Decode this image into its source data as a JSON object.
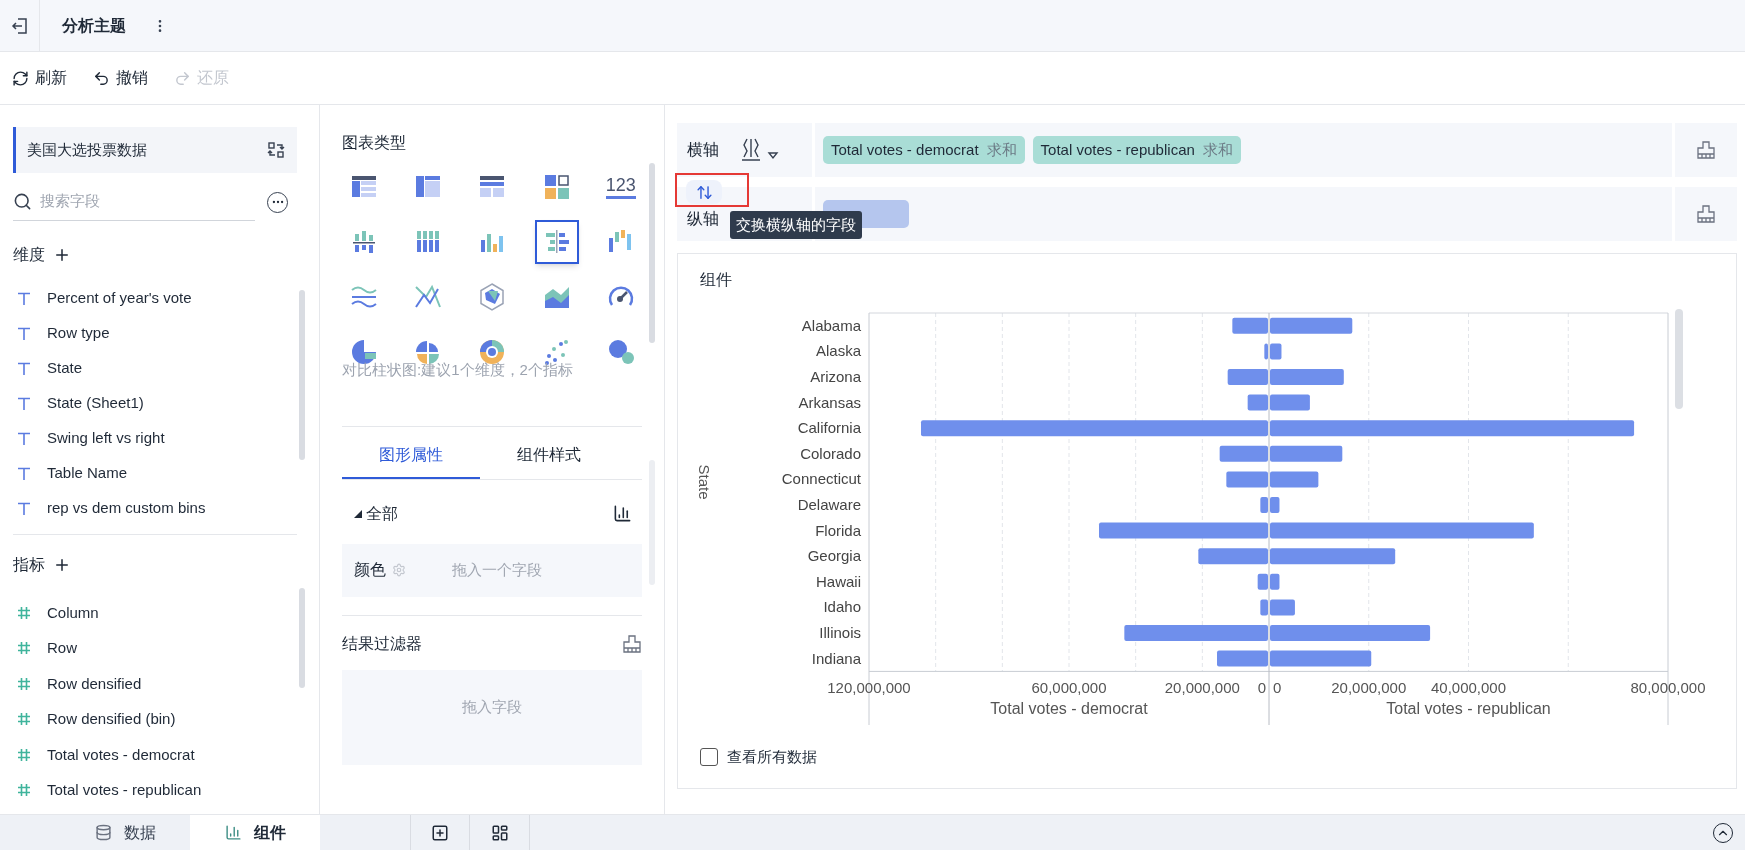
{
  "header": {
    "title": "分析主题"
  },
  "toolbar": [
    {
      "label": "刷新",
      "kind": "refresh",
      "disabled": false
    },
    {
      "label": "撤销",
      "kind": "undo",
      "disabled": false
    },
    {
      "label": "还原",
      "kind": "redo",
      "disabled": true
    }
  ],
  "dataset": {
    "name": "美国大选投票数据"
  },
  "search": {
    "placeholder": "搜索字段"
  },
  "dimensions": {
    "title": "维度",
    "fields": [
      "Percent of year's vote",
      "Row type",
      "State",
      "State (Sheet1)",
      "Swing left vs right",
      "Table Name",
      "rep vs dem custom bins"
    ]
  },
  "measures": {
    "title": "指标",
    "fields": [
      "Column",
      "Row",
      "Row densified",
      "Row densified (bin)",
      "Total votes - democrat",
      "Total votes - republican"
    ]
  },
  "chart_types": {
    "title": "图表类型",
    "hint": "对比柱状图:建议1个维度，2个指标",
    "items": [
      {
        "kind": "table",
        "selected": false
      },
      {
        "kind": "crosstab",
        "selected": false
      },
      {
        "kind": "detail",
        "selected": false
      },
      {
        "kind": "cards",
        "selected": false
      },
      {
        "kind": "number",
        "text": "123",
        "selected": false
      },
      {
        "kind": "grouped",
        "selected": false
      },
      {
        "kind": "stacked",
        "selected": false
      },
      {
        "kind": "column",
        "selected": false
      },
      {
        "kind": "butterfly",
        "selected": true
      },
      {
        "kind": "waterfall",
        "selected": false
      },
      {
        "kind": "wave",
        "selected": false
      },
      {
        "kind": "line",
        "selected": false
      },
      {
        "kind": "radar",
        "selected": false
      },
      {
        "kind": "area",
        "selected": false
      },
      {
        "kind": "gauge",
        "selected": false
      },
      {
        "kind": "pie",
        "selected": false
      },
      {
        "kind": "rose",
        "selected": false
      },
      {
        "kind": "sunburst",
        "selected": false
      },
      {
        "kind": "scatter",
        "selected": false
      },
      {
        "kind": "bubble",
        "selected": false
      }
    ]
  },
  "property_tabs": [
    {
      "label": "图形属性",
      "selected": true
    },
    {
      "label": "组件样式",
      "selected": false
    }
  ],
  "properties": {
    "group": "全部",
    "color_label": "颜色",
    "color_placeholder": "拖入一个字段"
  },
  "filter": {
    "title": "结果过滤器",
    "placeholder": "拖入字段"
  },
  "x_axis": {
    "label": "横轴",
    "fields": [
      {
        "name": "Total votes - democrat",
        "agg": "求和"
      },
      {
        "name": "Total votes - republican",
        "agg": "求和"
      }
    ]
  },
  "y_axis": {
    "label": "纵轴"
  },
  "tooltip": "交换横纵轴的字段",
  "chart_card": {
    "title": "组件",
    "charts": [
      {
        "chart_data": {
          "type": "bar",
          "orientation": "horizontal",
          "ylabel": "State",
          "xlabel": "Total votes - democrat",
          "xlim": [
            120000000,
            0
          ],
          "xticks": [
            {
              "value": 120000000,
              "label": "120,000,000"
            },
            {
              "value": 60000000,
              "label": "60,000,000"
            },
            {
              "value": 20000000,
              "label": "20,000,000"
            },
            {
              "value": 0,
              "label": "0"
            }
          ],
          "categories": [
            "Alabama",
            "Alaska",
            "Arizona",
            "Arkansas",
            "California",
            "Colorado",
            "Connecticut",
            "Delaware",
            "Florida",
            "Georgia",
            "Hawaii",
            "Idaho",
            "Illinois",
            "Indiana"
          ],
          "series": [
            {
              "color": "#6f8fec",
              "values": [
                11000000,
                1400000,
                12400000,
                6400000,
                104400000,
                14800000,
                12800000,
                2600000,
                51000000,
                21200000,
                3400000,
                2600000,
                43400000,
                15600000
              ]
            }
          ]
        }
      },
      {
        "chart_data": {
          "type": "bar",
          "orientation": "horizontal",
          "xlabel": "Total votes - republican",
          "xlim": [
            0,
            80000000
          ],
          "xticks": [
            {
              "value": 0,
              "label": "0"
            },
            {
              "value": 20000000,
              "label": "20,000,000"
            },
            {
              "value": 40000000,
              "label": "40,000,000"
            },
            {
              "value": 80000000,
              "label": "80,000,000"
            }
          ],
          "series": [
            {
              "color": "#6f8fec",
              "values": [
                16700000,
                2500000,
                15000000,
                8200000,
                73200000,
                14700000,
                9900000,
                2100000,
                53100000,
                25300000,
                2100000,
                5200000,
                32300000,
                20500000
              ]
            }
          ]
        }
      }
    ],
    "show_all": {
      "label": "查看所有数据",
      "checked": false
    }
  },
  "bottom_tabs": [
    {
      "label": "数据",
      "kind": "data",
      "selected": false
    },
    {
      "label": "组件",
      "kind": "component",
      "selected": true
    }
  ]
}
